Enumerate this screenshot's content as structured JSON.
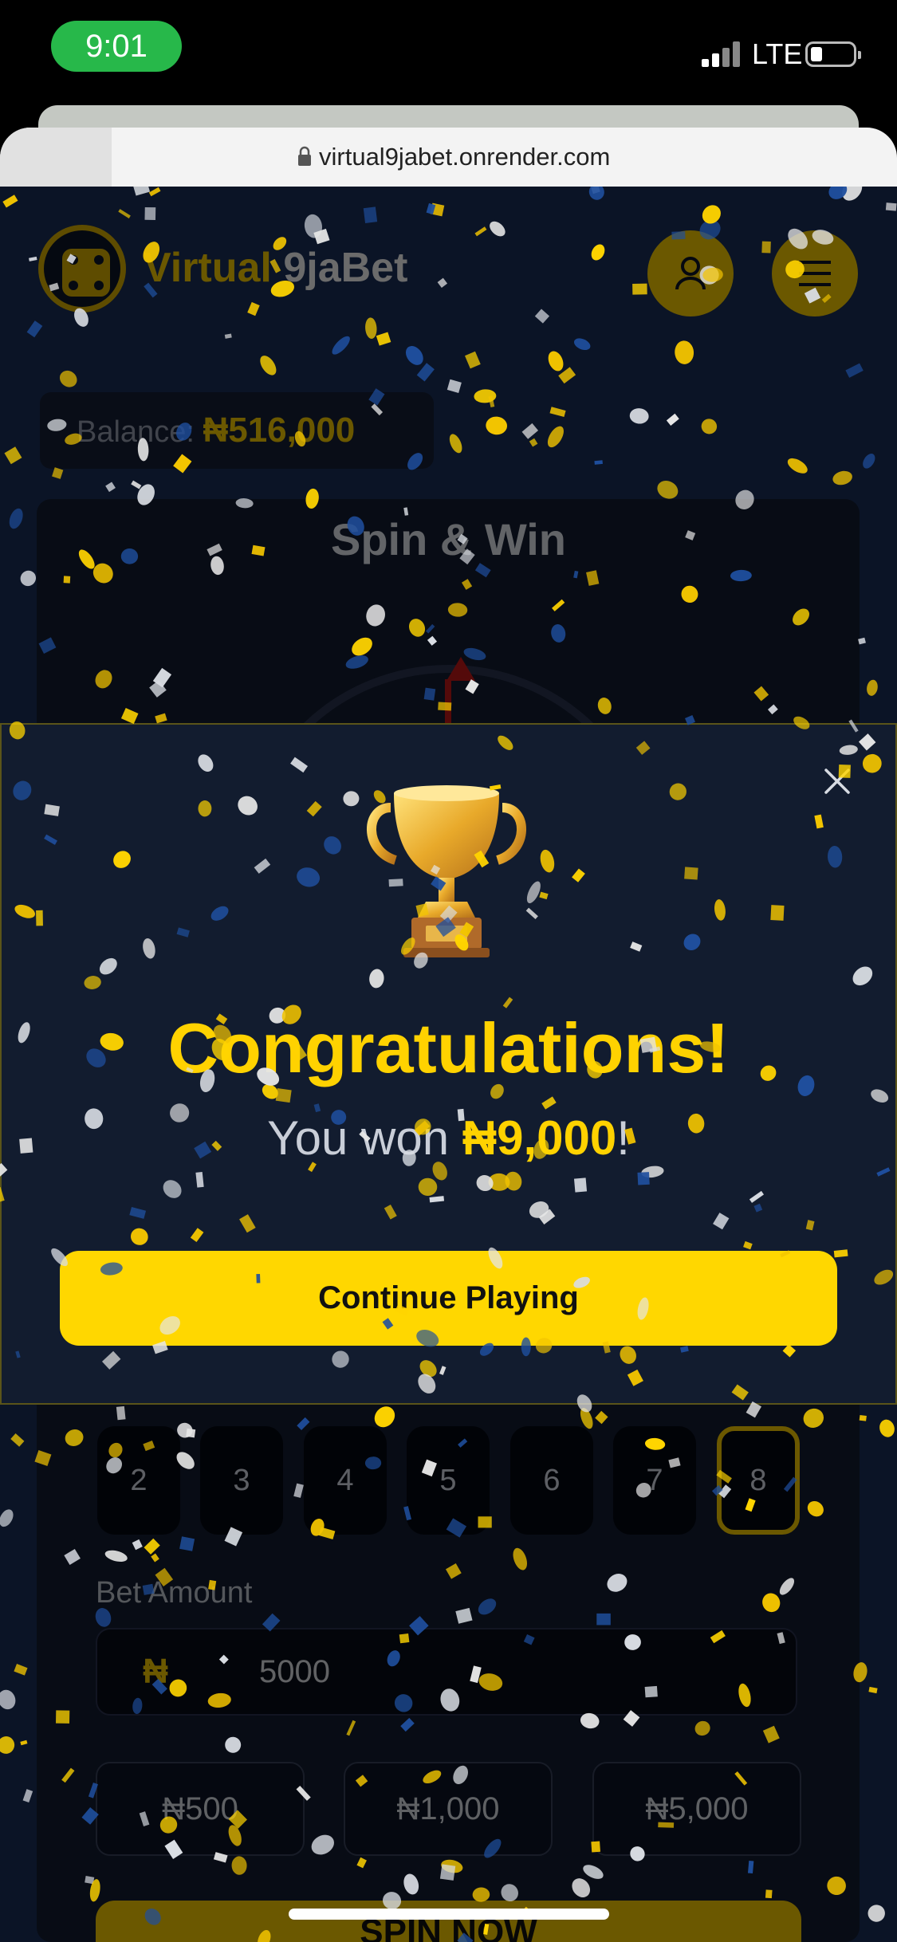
{
  "status_bar": {
    "time": "9:01",
    "network": "LTE"
  },
  "browser": {
    "url": "virtual9jabet.onrender.com"
  },
  "header": {
    "brand_part1": "Virtual",
    "brand_part2": "9jaBet"
  },
  "balance": {
    "label": "Balance:",
    "value": "₦516,000"
  },
  "game": {
    "title": "Spin & Win",
    "numbers": [
      "2",
      "3",
      "4",
      "5",
      "6",
      "7",
      "8"
    ],
    "selected_number": "8",
    "bet_label": "Bet Amount",
    "currency_symbol": "₦",
    "bet_value": "5000",
    "quick_amounts": [
      "₦500",
      "₦1,000",
      "₦5,000"
    ],
    "spin_label": "SPIN NOW"
  },
  "modal": {
    "heading": "Congratulations!",
    "won_prefix": "You won ",
    "won_amount": "₦9,000",
    "won_suffix": "!",
    "continue_label": "Continue Playing"
  },
  "colors": {
    "accent": "#ffd200",
    "background": "#0b1426",
    "modal_bg": "#121c2f"
  },
  "icons": [
    "lock-icon",
    "dice-icon",
    "user-icon",
    "menu-icon",
    "close-icon",
    "trophy-icon"
  ]
}
